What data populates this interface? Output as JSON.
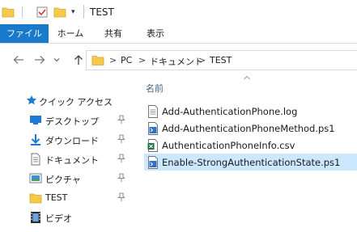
{
  "window": {
    "title": "TEST"
  },
  "ribbon": {
    "tabs": [
      {
        "label": "ファイル",
        "active": true
      },
      {
        "label": "ホーム"
      },
      {
        "label": "共有"
      },
      {
        "label": "表示"
      }
    ]
  },
  "address": {
    "breadcrumb": [
      "PC",
      "ドキュメント",
      "TEST"
    ],
    "separator": ">"
  },
  "nav_pane": {
    "quick_access_label": "クイック アクセス",
    "items": [
      {
        "label": "デスクトップ",
        "icon": "desktop-icon",
        "pinned": true
      },
      {
        "label": "ダウンロード",
        "icon": "download-icon",
        "pinned": true
      },
      {
        "label": "ドキュメント",
        "icon": "documents-icon",
        "pinned": true
      },
      {
        "label": "ピクチャ",
        "icon": "pictures-icon",
        "pinned": true
      },
      {
        "label": "TEST",
        "icon": "folder-icon",
        "pinned": true
      },
      {
        "label": "ビデオ",
        "icon": "videos-icon",
        "pinned": false
      }
    ]
  },
  "file_list": {
    "column_name": "名前",
    "files": [
      {
        "name": "Add-AuthenticationPhone.log",
        "icon": "text-file-icon",
        "selected": false
      },
      {
        "name": "Add-AuthenticationPhoneMethod.ps1",
        "icon": "powershell-script-icon",
        "selected": false
      },
      {
        "name": "AuthenticationPhoneInfo.csv",
        "icon": "excel-csv-icon",
        "selected": false
      },
      {
        "name": "Enable-StrongAuthenticationState.ps1",
        "icon": "powershell-script-icon",
        "selected": true
      }
    ]
  },
  "colors": {
    "file_tab": "#1979ca",
    "selection": "#cce8ff",
    "folder": "#f5c94a",
    "accent_blue": "#1e7ad6"
  }
}
